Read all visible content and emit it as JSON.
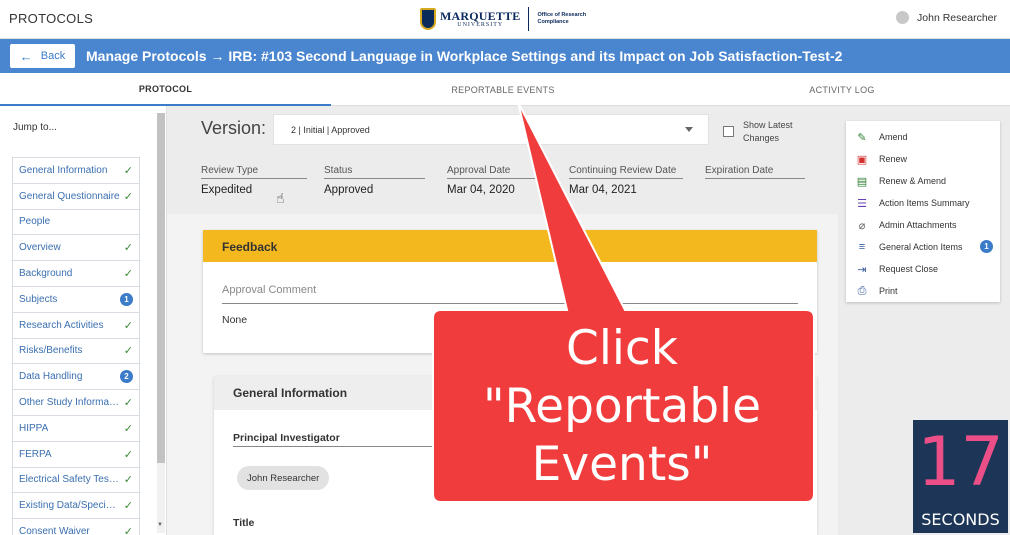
{
  "app": {
    "title": "PROTOCOLS",
    "user_name": "John Researcher"
  },
  "logo": {
    "name": "MARQUETTE",
    "sub": "UNIVERSITY",
    "office_line1": "Office of Research",
    "office_line2": "Compliance"
  },
  "header": {
    "back_label": "Back",
    "title": "Manage Protocols → IRB: #103 Second Language in Workplace Settings and its Impact on Job Satisfaction-Test-2"
  },
  "tabs": [
    {
      "label": "PROTOCOL",
      "active": true
    },
    {
      "label": "REPORTABLE EVENTS",
      "active": false
    },
    {
      "label": "ACTIVITY LOG",
      "active": false
    }
  ],
  "sidebar": {
    "jump_label": "Jump to...",
    "items": [
      {
        "label": "General Information",
        "status": "check"
      },
      {
        "label": "General Questionnaire",
        "status": "check"
      },
      {
        "label": "People",
        "status": ""
      },
      {
        "label": "Overview",
        "status": "check"
      },
      {
        "label": "Background",
        "status": "check"
      },
      {
        "label": "Subjects",
        "status": "1"
      },
      {
        "label": "Research Activities",
        "status": "check"
      },
      {
        "label": "Risks/Benefits",
        "status": "check"
      },
      {
        "label": "Data Handling",
        "status": "2"
      },
      {
        "label": "Other Study Information",
        "status": "check"
      },
      {
        "label": "HIPPA",
        "status": "check"
      },
      {
        "label": "FERPA",
        "status": "check"
      },
      {
        "label": "Electrical Safety Testing",
        "status": "check"
      },
      {
        "label": "Existing Data/Specimens",
        "status": "check"
      },
      {
        "label": "Consent Waiver",
        "status": "check"
      }
    ]
  },
  "version": {
    "label": "Version:",
    "selected": "2 | Initial | Approved",
    "show_latest_label": "Show Latest Changes"
  },
  "meta": [
    {
      "label": "Review Type",
      "value": "Expedited"
    },
    {
      "label": "Status",
      "value": "Approved"
    },
    {
      "label": "Approval Date",
      "value": "Mar 04, 2020"
    },
    {
      "label": "Continuing Review Date",
      "value": "Mar 04, 2021"
    },
    {
      "label": "Expiration Date",
      "value": ""
    }
  ],
  "feedback": {
    "title": "Feedback",
    "comment_label": "Approval Comment",
    "comment_value": "None"
  },
  "general": {
    "title": "General Information",
    "pi_label": "Principal Investigator",
    "pi_value": "John Researcher",
    "title_label": "Title"
  },
  "actions": [
    {
      "label": "Amend",
      "icon": "pencil-icon",
      "color": "#2e7d32",
      "glyph": "✎",
      "badge": ""
    },
    {
      "label": "Renew",
      "icon": "calendar-check-icon",
      "color": "#d32f2f",
      "glyph": "▣",
      "badge": ""
    },
    {
      "label": "Renew & Amend",
      "icon": "calendar-edit-icon",
      "color": "#2e7d32",
      "glyph": "▤",
      "badge": ""
    },
    {
      "label": "Action Items Summary",
      "icon": "list-icon",
      "color": "#6a3fb0",
      "glyph": "☰",
      "badge": ""
    },
    {
      "label": "Admin Attachments",
      "icon": "paperclip-icon",
      "color": "#666666",
      "glyph": "⌀",
      "badge": ""
    },
    {
      "label": "General Action Items",
      "icon": "message-icon",
      "color": "#3b5fa0",
      "glyph": "≡",
      "badge": "1"
    },
    {
      "label": "Request Close",
      "icon": "exit-icon",
      "color": "#3b5fa0",
      "glyph": "⇥",
      "badge": ""
    },
    {
      "label": "Print",
      "icon": "printer-icon",
      "color": "#3b5fa0",
      "glyph": "⎙",
      "badge": ""
    }
  ],
  "callout": {
    "line1": "Click",
    "line2": "\"Reportable",
    "line3": "Events\"",
    "color": "#f03c3c"
  },
  "timer": {
    "value": "17",
    "unit": "SECONDS"
  }
}
